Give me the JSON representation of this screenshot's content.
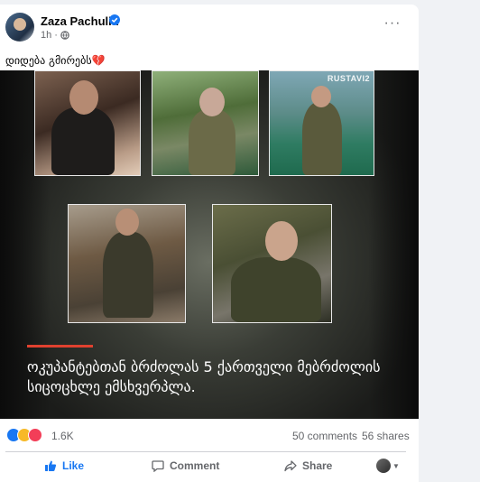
{
  "post": {
    "author": "Zaza Pachulia",
    "time": "1h",
    "time_separator": "·",
    "caption": "დიდება გმირებს💔",
    "more_label": "···"
  },
  "media": {
    "watermark": "RUSTAVI2",
    "headline": "ოკუპანტებთან ბრძოლას 5 ქართველი მებრძოლის სიცოცხლე ემსხვერპლა."
  },
  "stats": {
    "reactions_count": "1.6K",
    "comments": "50 comments",
    "shares": "56 shares"
  },
  "actions": {
    "like": "Like",
    "comment": "Comment",
    "share": "Share"
  },
  "colors": {
    "accent": "#1877f2",
    "headline_bar": "#e0412f",
    "muted_text": "#65676b"
  }
}
